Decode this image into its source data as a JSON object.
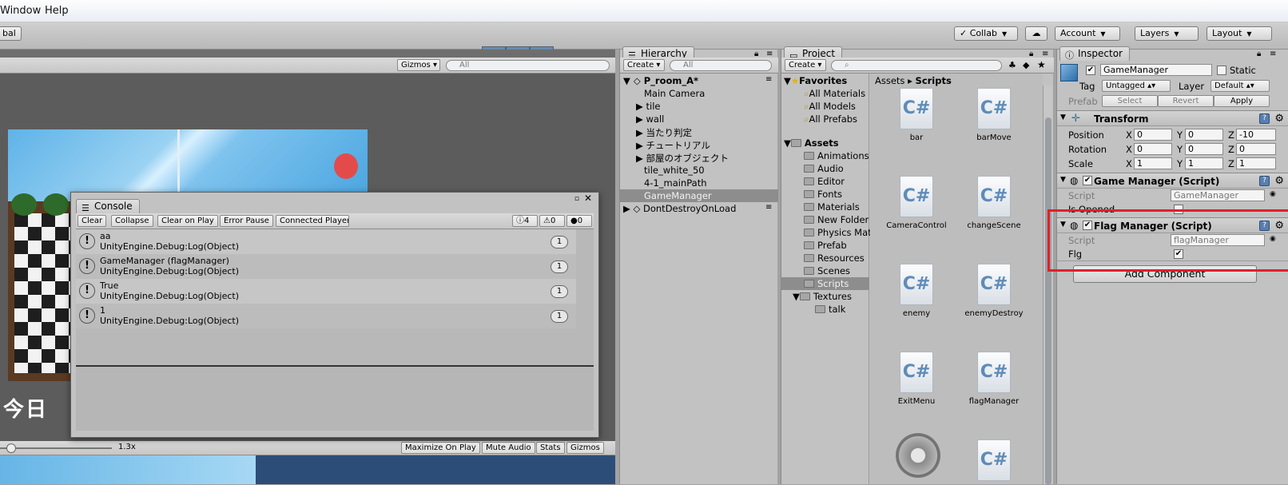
{
  "menubar": {
    "items": [
      "Window",
      "Help"
    ]
  },
  "toolbar": {
    "local_label": "bal",
    "play_icon": "play-icon",
    "pause_icon": "pause-icon",
    "step_icon": "step-icon",
    "collab_label": "Collab",
    "account_label": "Account",
    "layers_label": "Layers",
    "layout_label": "Layout"
  },
  "scene": {
    "gizmos_label": "Gizmos",
    "search_placeholder": "All",
    "banner_text": "今日",
    "scale_label": "1.3x",
    "bottom_buttons": [
      "Maximize On Play",
      "Mute Audio",
      "Stats",
      "Gizmos"
    ]
  },
  "console": {
    "title": "Console",
    "buttons": [
      "Clear",
      "Collapse",
      "Clear on Play",
      "Error Pause",
      "Connected Player"
    ],
    "counts": {
      "info": "4",
      "warn": "0",
      "error": "0"
    },
    "logs": [
      {
        "line1": "aa",
        "line2": "UnityEngine.Debug:Log(Object)",
        "count": "1"
      },
      {
        "line1": "GameManager (flagManager)",
        "line2": "UnityEngine.Debug:Log(Object)",
        "count": "1"
      },
      {
        "line1": "True",
        "line2": "UnityEngine.Debug:Log(Object)",
        "count": "1"
      },
      {
        "line1": "1",
        "line2": "UnityEngine.Debug:Log(Object)",
        "count": "1"
      }
    ]
  },
  "hierarchy": {
    "title": "Hierarchy",
    "create_label": "Create",
    "search_placeholder": "All",
    "scene_name": "P_room_A*",
    "items": [
      "Main Camera",
      "tile",
      "wall",
      "当たり判定",
      "チュートリアル",
      "部屋のオブジェクト",
      "tile_white_50",
      "4-1_mainPath",
      "GameManager"
    ],
    "dontdestroy": "DontDestroyOnLoad"
  },
  "project": {
    "title": "Project",
    "create_label": "Create",
    "favorites_label": "Favorites",
    "favorites": [
      "All Materials",
      "All Models",
      "All Prefabs"
    ],
    "assets_label": "Assets",
    "folders": [
      "Animations",
      "Audio",
      "Editor",
      "Fonts",
      "Materials",
      "New Folder",
      "Physics Mat",
      "Prefab",
      "Resources",
      "Scenes",
      "Scripts",
      "Textures"
    ],
    "subfolder": "talk",
    "breadcrumb_root": "Assets",
    "breadcrumb_current": "Scripts",
    "files": [
      "bar",
      "barMove",
      "CameraControl",
      "changeScene",
      "enemy",
      "enemyDestroy",
      "ExitMenu",
      "flagManager"
    ]
  },
  "inspector": {
    "title": "Inspector",
    "object_name": "GameManager",
    "static_label": "Static",
    "tag_label": "Tag",
    "tag_value": "Untagged",
    "layer_label": "Layer",
    "layer_value": "Default",
    "prefab_label": "Prefab",
    "prefab_buttons": [
      "Select",
      "Revert",
      "Apply"
    ],
    "transform": {
      "title": "Transform",
      "position_label": "Position",
      "rotation_label": "Rotation",
      "scale_label": "Scale",
      "position": [
        "0",
        "0",
        "-10"
      ],
      "rotation": [
        "0",
        "0",
        "0"
      ],
      "scale": [
        "1",
        "1",
        "1"
      ]
    },
    "game_manager": {
      "title": "Game Manager (Script)",
      "script_label": "Script",
      "script_value": "GameManager",
      "field_label": "Is Opened"
    },
    "flag_manager": {
      "title": "Flag Manager (Script)",
      "script_label": "Script",
      "script_value": "flagManager",
      "field_label": "Flg"
    },
    "add_component": "Add Component"
  },
  "colors": {
    "highlight_box": "#e0202a",
    "play_blue": "#4a76a8",
    "selected_row": "#8d8d8d"
  }
}
